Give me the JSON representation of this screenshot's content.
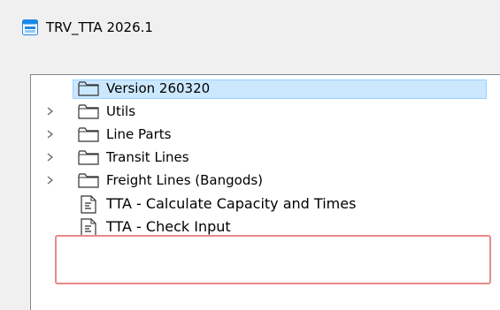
{
  "window": {
    "title": "TRV_TTA 2026.1",
    "icon": "app-window-icon"
  },
  "tree": {
    "items": [
      {
        "label": "Version 260320",
        "icon": "folder-icon",
        "expandable": false,
        "selected": true
      },
      {
        "label": "Utils",
        "icon": "folder-icon",
        "expandable": true,
        "selected": false
      },
      {
        "label": "Line Parts",
        "icon": "folder-icon",
        "expandable": true,
        "selected": false
      },
      {
        "label": "Transit Lines",
        "icon": "folder-icon",
        "expandable": true,
        "selected": false
      },
      {
        "label": "Freight Lines (Bangods)",
        "icon": "folder-icon",
        "expandable": true,
        "selected": false
      },
      {
        "label": "TTA - Calculate Capacity and Times",
        "icon": "script-file-icon",
        "expandable": false,
        "selected": false
      },
      {
        "label": "TTA - Check Input",
        "icon": "script-file-icon",
        "expandable": false,
        "selected": false
      }
    ]
  },
  "colors": {
    "selection": "#cce8ff",
    "selection_border": "#99d1ff",
    "highlight_border": "#e88a8a",
    "app_icon": "#1e88e5"
  }
}
